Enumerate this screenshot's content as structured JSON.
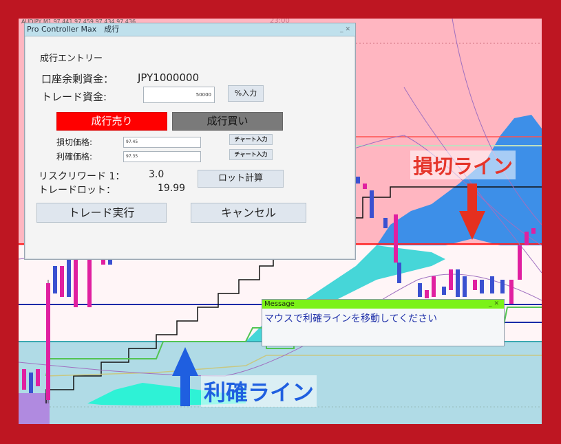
{
  "chart": {
    "ticker": "AUDJPY,M1  97.441 97.459 97.434 97.436",
    "top_time": "23:00"
  },
  "controller": {
    "title": "Pro Controller Max　成行",
    "section_title": "成行エントリー",
    "balance_label": "口座余剰資金：",
    "balance_value": "JPY1000000",
    "capital_label": "トレード資金:",
    "capital_value": "50000",
    "percent_button": "%入力",
    "sell_button": "成行売り",
    "buy_button": "成行買い",
    "stoploss_label": "損切価格:",
    "stoploss_value": "97.45",
    "takeprofit_label": "利確価格:",
    "takeprofit_value": "97.35",
    "chart_input_button": "チャート入力",
    "risk_reward_label": "リスクリワード  1：",
    "risk_reward_value": "3.0",
    "lot_label": "トレードロット：",
    "lot_value": "19.99",
    "lot_calc_button": "ロット計算",
    "execute_button": "トレード実行",
    "cancel_button": "キャンセル"
  },
  "message": {
    "title": "Message",
    "text": "マウスで利確ラインを移動してください"
  },
  "callouts": {
    "stoploss": "損切ライン",
    "takeprofit": "利確ライン"
  },
  "colors": {
    "frame": "#be1622",
    "stoploss_zone": "#ffb6c1",
    "takeprofit_zone": "#b0dbe6",
    "sell": "#ff0000",
    "buy": "#7a7a7a",
    "arrow_down": "#e53020",
    "arrow_up": "#1f5fe0",
    "message_title": "#7bf218"
  }
}
